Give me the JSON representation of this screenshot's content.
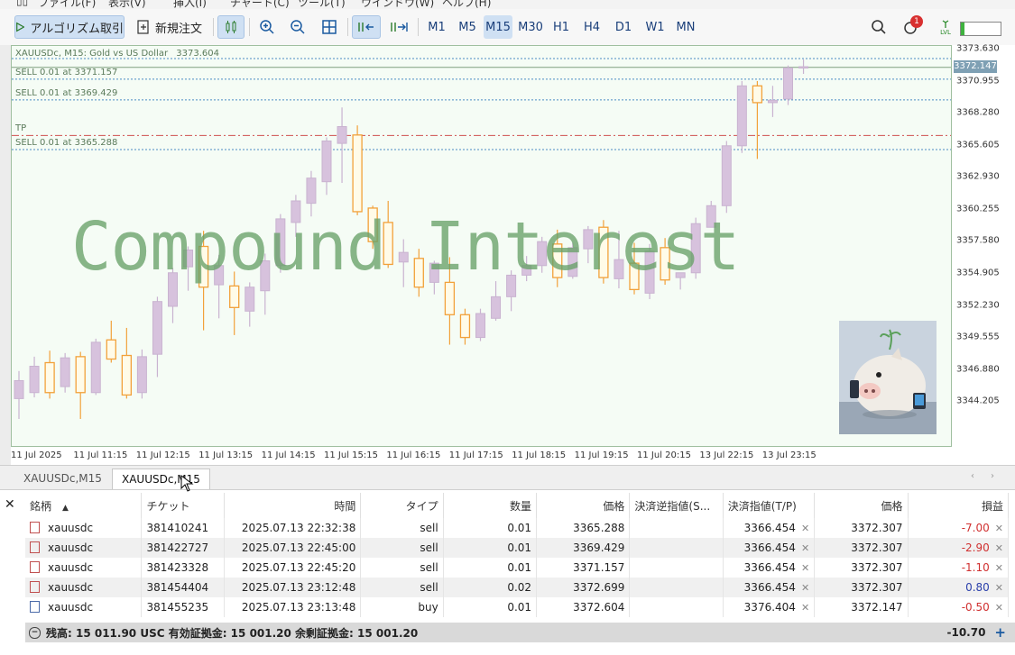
{
  "menu": [
    "ファイル(F)",
    "表示(V)",
    "挿入(I)",
    "チャート(C)",
    "ツール(T)",
    "ウインドウ(W)",
    "ヘルプ(H)"
  ],
  "toolbar": {
    "algo_label": "アルゴリズム取引",
    "new_order_label": "新規注文",
    "timeframes": [
      "M1",
      "M5",
      "M15",
      "M30",
      "H1",
      "H4",
      "D1",
      "W1",
      "MN"
    ],
    "active_timeframe": "M15",
    "notification_count": "1",
    "lvl_label": "LVL"
  },
  "chart": {
    "header": "XAUUSDc, M15:  Gold vs US Dollar",
    "header_price": "3373.604",
    "watermark": "Compound Interest",
    "current_price": "3372.147",
    "price_min": 3342.5,
    "price_max": 3373.63,
    "price_ticks": [
      "3373.630",
      "3370.955",
      "3368.280",
      "3365.605",
      "3362.930",
      "3360.255",
      "3357.580",
      "3354.905",
      "3352.230",
      "3349.555",
      "3346.880",
      "3344.205"
    ],
    "time_ticks": [
      "11 Jul 2025",
      "11 Jul 11:15",
      "11 Jul 12:15",
      "11 Jul 13:15",
      "11 Jul 14:15",
      "11 Jul 15:15",
      "11 Jul 16:15",
      "11 Jul 17:15",
      "11 Jul 18:15",
      "11 Jul 19:15",
      "11 Jul 20:15",
      "13 Jul 22:15",
      "13 Jul 23:15"
    ],
    "levels": [
      {
        "label": "SELL 0.01 at 3371.157",
        "price": 3371.157,
        "color": "#4a8cc4",
        "style": "dotted"
      },
      {
        "label": "SELL 0.01 at 3369.429",
        "price": 3369.429,
        "color": "#4a8cc4",
        "style": "dotted"
      },
      {
        "label": "TP",
        "price": 3366.454,
        "color": "#d05050",
        "style": "dashdot"
      },
      {
        "label": "SELL 0.01 at 3365.288",
        "price": 3365.288,
        "color": "#4a8cc4",
        "style": "dotted"
      }
    ],
    "bull_color": "#d7c2dd",
    "bear_color": "#f2a13a",
    "candles": [
      {
        "o": 3344.5,
        "h": 3346.8,
        "l": 3342.8,
        "c": 3346.0
      },
      {
        "o": 3345.0,
        "h": 3348.0,
        "l": 3344.6,
        "c": 3347.2
      },
      {
        "o": 3347.5,
        "h": 3348.5,
        "l": 3344.5,
        "c": 3345.0
      },
      {
        "o": 3345.5,
        "h": 3348.3,
        "l": 3345.0,
        "c": 3347.9
      },
      {
        "o": 3348.0,
        "h": 3348.4,
        "l": 3342.8,
        "c": 3345.0
      },
      {
        "o": 3345.0,
        "h": 3349.5,
        "l": 3344.8,
        "c": 3349.2
      },
      {
        "o": 3349.4,
        "h": 3351.0,
        "l": 3347.5,
        "c": 3347.8
      },
      {
        "o": 3348.1,
        "h": 3350.4,
        "l": 3344.5,
        "c": 3344.8
      },
      {
        "o": 3345.0,
        "h": 3348.6,
        "l": 3344.5,
        "c": 3348.0
      },
      {
        "o": 3348.2,
        "h": 3353.0,
        "l": 3346.3,
        "c": 3352.6
      },
      {
        "o": 3352.2,
        "h": 3355.4,
        "l": 3350.8,
        "c": 3355.0
      },
      {
        "o": 3355.5,
        "h": 3357.2,
        "l": 3353.5,
        "c": 3356.9
      },
      {
        "o": 3357.2,
        "h": 3358.5,
        "l": 3350.2,
        "c": 3353.8
      },
      {
        "o": 3354.0,
        "h": 3356.5,
        "l": 3351.2,
        "c": 3355.6
      },
      {
        "o": 3353.9,
        "h": 3355.1,
        "l": 3349.8,
        "c": 3352.1
      },
      {
        "o": 3351.8,
        "h": 3354.2,
        "l": 3350.5,
        "c": 3353.8
      },
      {
        "o": 3353.5,
        "h": 3356.6,
        "l": 3351.5,
        "c": 3356.0
      },
      {
        "o": 3355.6,
        "h": 3359.9,
        "l": 3355.0,
        "c": 3359.5
      },
      {
        "o": 3359.2,
        "h": 3361.5,
        "l": 3358.0,
        "c": 3361.0
      },
      {
        "o": 3360.8,
        "h": 3363.5,
        "l": 3359.7,
        "c": 3362.9
      },
      {
        "o": 3362.6,
        "h": 3366.3,
        "l": 3361.5,
        "c": 3366.0
      },
      {
        "o": 3365.8,
        "h": 3368.8,
        "l": 3362.5,
        "c": 3367.2
      },
      {
        "o": 3366.5,
        "h": 3367.3,
        "l": 3359.8,
        "c": 3360.1
      },
      {
        "o": 3360.4,
        "h": 3360.6,
        "l": 3357.0,
        "c": 3357.6
      },
      {
        "o": 3359.2,
        "h": 3361.0,
        "l": 3355.4,
        "c": 3355.7
      },
      {
        "o": 3355.9,
        "h": 3357.8,
        "l": 3353.8,
        "c": 3356.7
      },
      {
        "o": 3356.2,
        "h": 3357.0,
        "l": 3353.0,
        "c": 3353.8
      },
      {
        "o": 3354.2,
        "h": 3356.0,
        "l": 3353.2,
        "c": 3355.8
      },
      {
        "o": 3354.2,
        "h": 3356.3,
        "l": 3349.0,
        "c": 3351.5
      },
      {
        "o": 3351.5,
        "h": 3352.0,
        "l": 3349.0,
        "c": 3349.6
      },
      {
        "o": 3349.6,
        "h": 3352.0,
        "l": 3349.3,
        "c": 3351.6
      },
      {
        "o": 3351.2,
        "h": 3354.3,
        "l": 3351.0,
        "c": 3353.0
      },
      {
        "o": 3353.0,
        "h": 3355.2,
        "l": 3351.8,
        "c": 3354.8
      },
      {
        "o": 3354.8,
        "h": 3356.4,
        "l": 3354.3,
        "c": 3355.6
      },
      {
        "o": 3355.6,
        "h": 3358.0,
        "l": 3355.0,
        "c": 3357.6
      },
      {
        "o": 3357.4,
        "h": 3358.6,
        "l": 3353.8,
        "c": 3354.6
      },
      {
        "o": 3354.7,
        "h": 3357.5,
        "l": 3354.5,
        "c": 3357.1
      },
      {
        "o": 3357.0,
        "h": 3358.9,
        "l": 3355.8,
        "c": 3358.6
      },
      {
        "o": 3358.8,
        "h": 3359.4,
        "l": 3354.1,
        "c": 3354.6
      },
      {
        "o": 3354.5,
        "h": 3358.5,
        "l": 3353.7,
        "c": 3356.1
      },
      {
        "o": 3355.8,
        "h": 3357.5,
        "l": 3353.2,
        "c": 3353.6
      },
      {
        "o": 3353.3,
        "h": 3357.4,
        "l": 3352.8,
        "c": 3356.8
      },
      {
        "o": 3357.1,
        "h": 3357.9,
        "l": 3354.0,
        "c": 3354.4
      },
      {
        "o": 3354.6,
        "h": 3355.0,
        "l": 3353.6,
        "c": 3355.0
      },
      {
        "o": 3355.0,
        "h": 3359.6,
        "l": 3354.5,
        "c": 3359.1
      },
      {
        "o": 3358.8,
        "h": 3361.0,
        "l": 3360.0,
        "c": 3360.6
      },
      {
        "o": 3360.6,
        "h": 3366.0,
        "l": 3360.0,
        "c": 3365.6
      },
      {
        "o": 3365.6,
        "h": 3371.0,
        "l": 3365.0,
        "c": 3370.6
      },
      {
        "o": 3370.6,
        "h": 3371.0,
        "l": 3364.5,
        "c": 3369.2
      },
      {
        "o": 3369.2,
        "h": 3370.6,
        "l": 3368.0,
        "c": 3369.4
      },
      {
        "o": 3369.5,
        "h": 3372.3,
        "l": 3369.0,
        "c": 3372.1
      },
      {
        "o": 3372.1,
        "h": 3372.8,
        "l": 3371.6,
        "c": 3372.2
      }
    ]
  },
  "tabs": [
    "XAUUSDc,M15",
    "XAUUSDc,M15"
  ],
  "active_tab": 1,
  "table": {
    "headers": [
      "銘柄",
      "チケット",
      "時間",
      "タイプ",
      "数量",
      "価格",
      "決済逆指値(S...",
      "決済指値(T/P)",
      "価格",
      "損益"
    ],
    "rows": [
      {
        "symbol": "xauusdc",
        "ticket": "381410241",
        "time": "2025.07.13 22:32:38",
        "type": "sell",
        "volume": "0.01",
        "price": "3365.288",
        "sl": "",
        "tp": "3366.454",
        "current": "3372.307",
        "profit": "-7.00",
        "sign": "neg"
      },
      {
        "symbol": "xauusdc",
        "ticket": "381422727",
        "time": "2025.07.13 22:45:00",
        "type": "sell",
        "volume": "0.01",
        "price": "3369.429",
        "sl": "",
        "tp": "3366.454",
        "current": "3372.307",
        "profit": "-2.90",
        "sign": "neg"
      },
      {
        "symbol": "xauusdc",
        "ticket": "381423328",
        "time": "2025.07.13 22:45:20",
        "type": "sell",
        "volume": "0.01",
        "price": "3371.157",
        "sl": "",
        "tp": "3366.454",
        "current": "3372.307",
        "profit": "-1.10",
        "sign": "neg"
      },
      {
        "symbol": "xauusdc",
        "ticket": "381454404",
        "time": "2025.07.13 23:12:48",
        "type": "sell",
        "volume": "0.02",
        "price": "3372.699",
        "sl": "",
        "tp": "3366.454",
        "current": "3372.307",
        "profit": "0.80",
        "sign": "pos"
      },
      {
        "symbol": "xauusdc",
        "ticket": "381455235",
        "time": "2025.07.13 23:13:48",
        "type": "buy",
        "volume": "0.01",
        "price": "3372.604",
        "sl": "",
        "tp": "3376.404",
        "current": "3372.147",
        "profit": "-0.50",
        "sign": "neg"
      }
    ],
    "summary": "残高: 15 011.90 USC  有効証拠金: 15 001.20  余剰証拠金: 15 001.20",
    "total_profit": "-10.70"
  }
}
